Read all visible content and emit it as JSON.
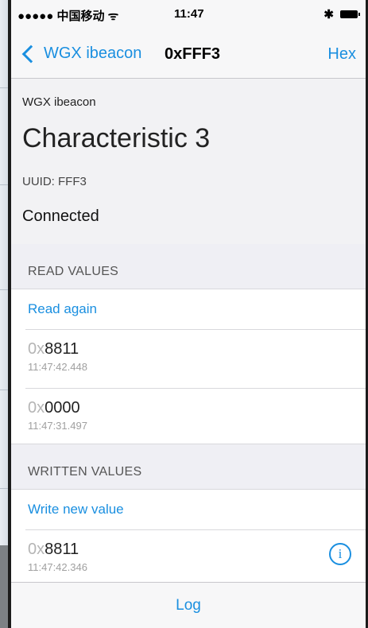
{
  "status_bar": {
    "carrier": "●●●●● 中国移动 ᯤ",
    "time": "11:47",
    "bluetooth": "✱"
  },
  "nav": {
    "back_label": "WGX ibeacon",
    "title": "0xFFF3",
    "right_label": "Hex"
  },
  "info": {
    "device_name": "WGX ibeacon",
    "characteristic": "Characteristic 3",
    "uuid": "UUID: FFF3",
    "status": "Connected"
  },
  "read_section": {
    "header": "READ VALUES",
    "action": "Read again",
    "values": [
      {
        "prefix": "0x",
        "hex": "8811",
        "time": "11:47:42.448"
      },
      {
        "prefix": "0x",
        "hex": "0000",
        "time": "11:47:31.497"
      }
    ]
  },
  "write_section": {
    "header": "WRITTEN VALUES",
    "action": "Write new value",
    "values": [
      {
        "prefix": "0x",
        "hex": "8811",
        "time": "11:47:42.346",
        "info_icon": "i"
      }
    ]
  },
  "toolbar": {
    "log_label": "Log"
  },
  "colors": {
    "accent": "#1a8fe0",
    "section_bg": "#efeff4",
    "bar_bg": "#f7f7f8"
  }
}
